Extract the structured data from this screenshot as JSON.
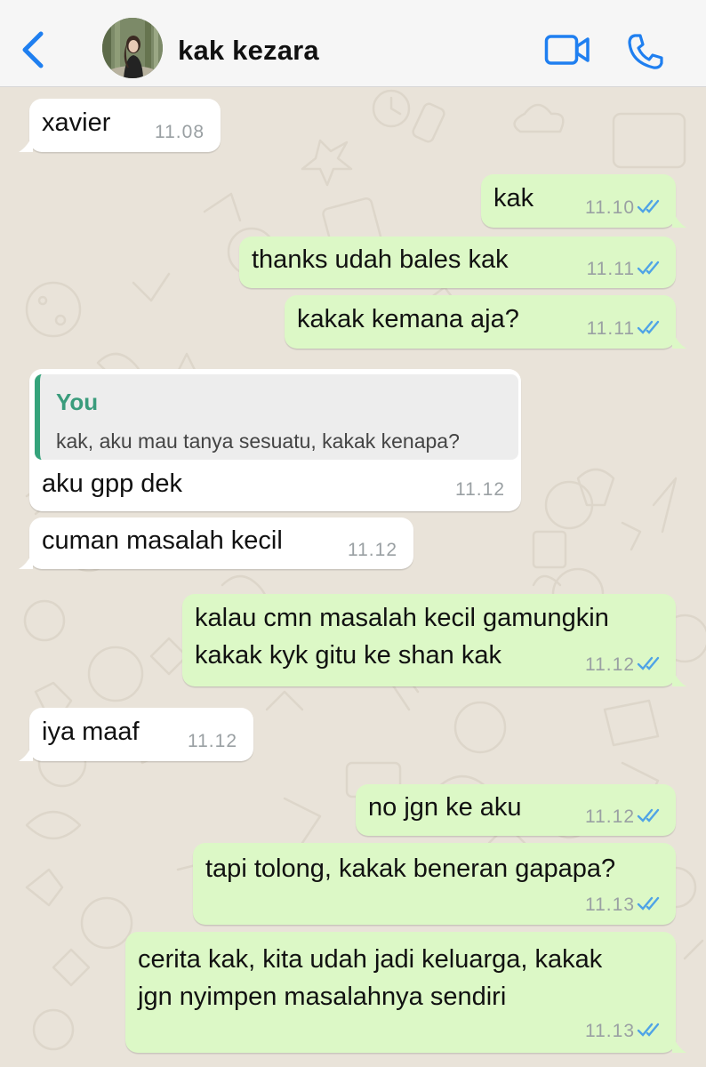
{
  "header": {
    "contact_name": "kak kezara",
    "accent_color": "#1f7ff0"
  },
  "messages": [
    {
      "direction": "incoming",
      "text": "xavier",
      "time": "11.08"
    },
    {
      "direction": "outgoing",
      "text": "kak",
      "time": "11.10",
      "status": "read"
    },
    {
      "direction": "outgoing",
      "text": "thanks udah bales kak",
      "time": "11.11",
      "status": "read"
    },
    {
      "direction": "outgoing",
      "text": "kakak kemana aja?",
      "time": "11.11",
      "status": "read"
    },
    {
      "direction": "incoming",
      "quote_author": "You",
      "quote_text": "kak, aku mau tanya sesuatu, kakak kenapa?",
      "text": "aku gpp dek",
      "time": "11.12"
    },
    {
      "direction": "incoming",
      "text": "cuman masalah kecil",
      "time": "11.12"
    },
    {
      "direction": "outgoing",
      "text_lines": [
        "kalau cmn masalah kecil gamungkin",
        "kakak kyk gitu ke shan kak"
      ],
      "time": "11.12",
      "status": "read"
    },
    {
      "direction": "incoming",
      "text": "iya maaf",
      "time": "11.12"
    },
    {
      "direction": "outgoing",
      "text": "no jgn ke aku",
      "time": "11.12",
      "status": "read"
    },
    {
      "direction": "outgoing",
      "text": "tapi tolong, kakak beneran gapapa?",
      "time": "11.13",
      "status": "read"
    },
    {
      "direction": "outgoing",
      "text_lines": [
        "cerita kak, kita udah jadi keluarga, kakak",
        "jgn nyimpen masalahnya sendiri"
      ],
      "time": "11.13",
      "status": "read"
    }
  ],
  "colors": {
    "incoming_bubble": "#ffffff",
    "outgoing_bubble": "#dcf8c6",
    "chat_background": "#e9e3d9",
    "read_ticks": "#4fa3e6",
    "reply_bar": "#35a37b"
  }
}
